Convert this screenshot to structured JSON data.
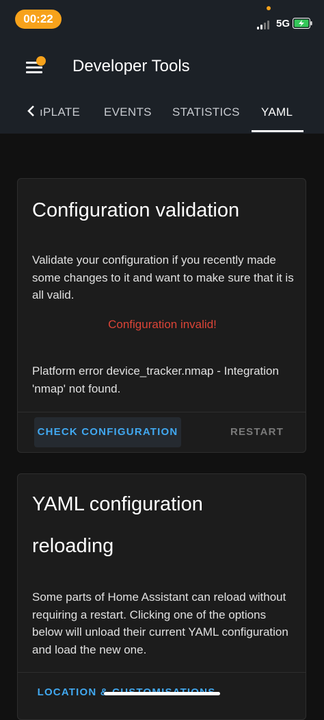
{
  "status_bar": {
    "time": "00:22",
    "network": "5G"
  },
  "header": {
    "title": "Developer Tools"
  },
  "tabs": [
    {
      "label": "ıPLATE"
    },
    {
      "label": "EVENTS"
    },
    {
      "label": "STATISTICS"
    },
    {
      "label": "YAML",
      "active": true
    }
  ],
  "config_card": {
    "title": "Configuration validation",
    "description": "Validate your configuration if you recently made some changes to it and want to make sure that it is all valid.",
    "status": "Configuration invalid!",
    "error_message": "Platform error device_tracker.nmap - Integration 'nmap' not found.",
    "check_button": "CHECK CONFIGURATION",
    "restart_button": "RESTART"
  },
  "reload_card": {
    "title_line1": "YAML configuration",
    "title_line2": "reloading",
    "description": "Some parts of Home Assistant can reload without requiring a restart. Clicking one of the options below will unload their current YAML configuration and load the new one.",
    "first_option": "LOCATION & CUSTOMISATIONS"
  },
  "colors": {
    "accent": "#f7a21b",
    "link": "#41a8f0",
    "error": "#db4437",
    "header_bg": "#1c2127"
  }
}
